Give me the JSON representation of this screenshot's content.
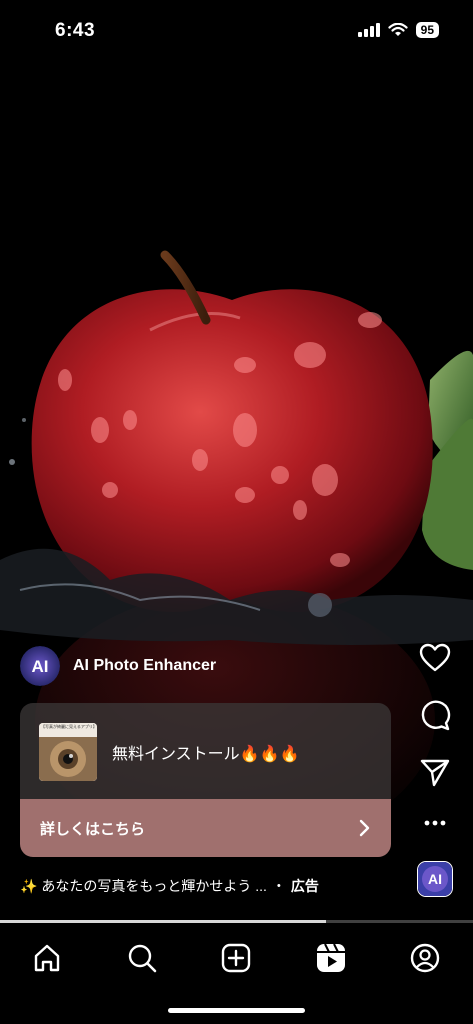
{
  "status_bar": {
    "time": "6:43",
    "battery": "95"
  },
  "post": {
    "author_name": "AI Photo Enhancer",
    "caption": "✨ あなたの写真をもっと輝かせよう ...",
    "caption_separator": "・",
    "sponsored_label": "広告"
  },
  "ad_card": {
    "title": "無料インストール🔥🔥🔥",
    "cta_label": "詳しくはこちら",
    "thumbnail_caption": "【写真が綺麗に見えるアプリ】"
  },
  "reel_progress": 0.69,
  "icons": {
    "like": "heart-icon",
    "comment": "comment-icon",
    "share": "send-icon",
    "more": "more-icon",
    "nav_home": "home-icon",
    "nav_search": "search-icon",
    "nav_create": "create-icon",
    "nav_reels": "reels-icon",
    "nav_profile": "profile-icon"
  },
  "colors": {
    "cta": "#a0706e",
    "card": "#3a3636",
    "background": "#000000"
  }
}
